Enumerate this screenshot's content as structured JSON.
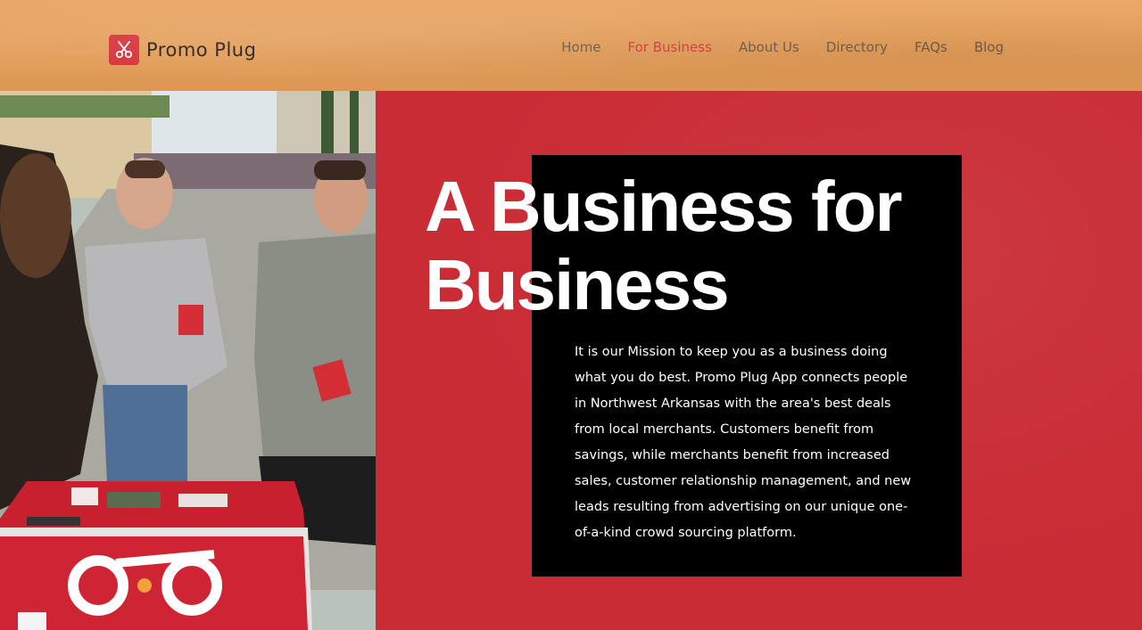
{
  "brand": {
    "name": "Promo Plug",
    "logo_icon": "scissors-icon"
  },
  "nav": {
    "items": [
      {
        "label": "Home",
        "active": false
      },
      {
        "label": "For Business",
        "active": true
      },
      {
        "label": "About Us",
        "active": false
      },
      {
        "label": "Directory",
        "active": false
      },
      {
        "label": "FAQs",
        "active": false
      },
      {
        "label": "Blog",
        "active": false
      }
    ]
  },
  "hero": {
    "headline": "A Business for Business",
    "mission": "It is our Mission to keep you as a business doing what you do best. Promo Plug App connects people in Northwest Arkansas with the area's best deals from local merchants. Customers benefit from savings, while merchants benefit from increased sales, customer relationship management, and new leads resulting from advertising on our unique one-of-a-kind crowd sourcing platform."
  },
  "colors": {
    "accent": "#d53a3e",
    "hero_red": "#c92c35",
    "header_tan": "#e39f5c",
    "nav_text": "#6d5a4a",
    "box_black": "#000000"
  }
}
